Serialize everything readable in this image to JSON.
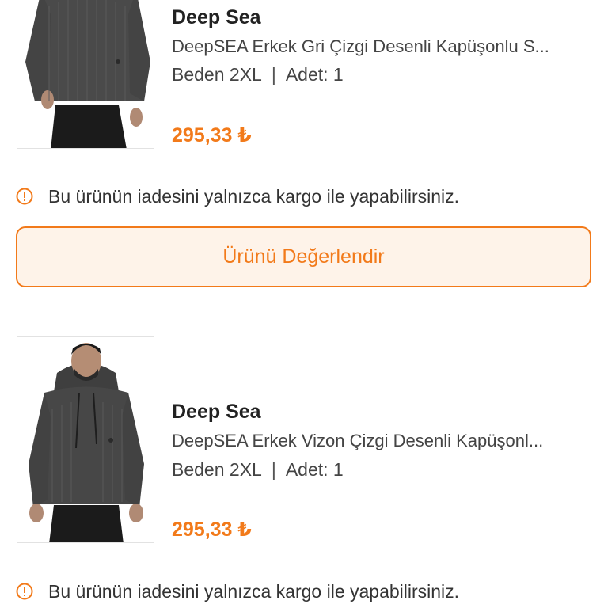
{
  "colors": {
    "accent": "#f27a1a",
    "button_bg": "#fef3e9",
    "text_dark": "#222222",
    "text_body": "#444444"
  },
  "items": [
    {
      "brand": "Deep Sea",
      "title": "DeepSEA Erkek Gri Çizgi Desenli Kapüşonlu S...",
      "size": "Beden 2XL",
      "separator": "|",
      "quantity": "Adet: 1",
      "price": "295,33 ₺",
      "notice": "Bu ürünün iadesini yalnızca kargo ile yapabilirsiniz.",
      "notice_icon": "info-circle-icon",
      "rate_button": "Ürünü Değerlendir"
    },
    {
      "brand": "Deep Sea",
      "title": "DeepSEA Erkek Vizon Çizgi Desenli Kapüşonl...",
      "size": "Beden 2XL",
      "separator": "|",
      "quantity": "Adet: 1",
      "price": "295,33 ₺",
      "notice": "Bu ürünün iadesini yalnızca kargo ile yapabilirsiniz.",
      "notice_icon": "info-circle-icon"
    }
  ]
}
